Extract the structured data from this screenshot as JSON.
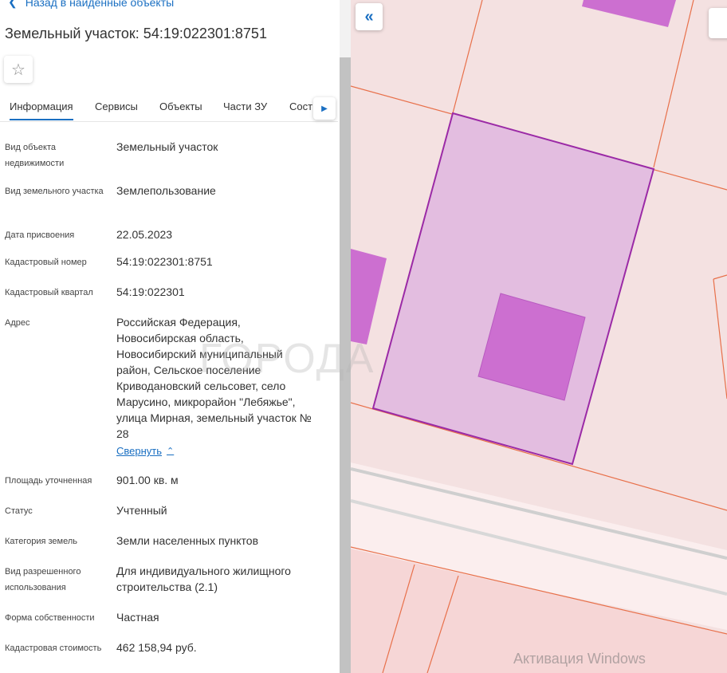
{
  "nav": {
    "back_label": "Назад в найденные объекты"
  },
  "object": {
    "title": "Земельный участок: 54:19:022301:8751"
  },
  "tabs": [
    {
      "label": "Информация"
    },
    {
      "label": "Сервисы"
    },
    {
      "label": "Объекты"
    },
    {
      "label": "Части ЗУ"
    },
    {
      "label": "Сост"
    }
  ],
  "details": {
    "type_label": "Вид объекта недвижимости",
    "type_value": "Земельный участок",
    "plot_kind_label": "Вид земельного участка",
    "plot_kind_value": "Землепользование",
    "date_label": "Дата присвоения",
    "date_value": "22.05.2023",
    "cad_number_label": "Кадастровый номер",
    "cad_number_value": "54:19:022301:8751",
    "cad_quarter_label": "Кадастровый квартал",
    "cad_quarter_value": "54:19:022301",
    "address_label": "Адрес",
    "address_value": "Российская Федерация, Новосибирская область, Новосибирский муниципальный район, Сельское поселение Криводановский сельсовет, село Марусино, микрорайон \"Лебяжье\", улица Мирная, земельный участок № 28",
    "collapse_label": "Свернуть",
    "area_label": "Площадь уточненная",
    "area_value": "901.00 кв. м",
    "status_label": "Статус",
    "status_value": "Учтенный",
    "category_label": "Категория земель",
    "category_value": "Земли населенных пунктов",
    "use_label": "Вид разрешенного использования",
    "use_value": "Для индивидуального жилищного строительства (2.1)",
    "ownership_label": "Форма собственности",
    "ownership_value": "Частная",
    "cost_label": "Кадастровая стоимость",
    "cost_value": "462 158,94 руб."
  },
  "watermark": "ГОРОДА",
  "os_notice": "Активация Windows",
  "icons": {
    "back": "chevron-left-icon",
    "favorite": "star-icon",
    "tab_scroll": "triangle-right-icon",
    "collapse_panel": "double-chevron-left-icon"
  },
  "colors": {
    "accent": "#1a6fc2",
    "parcel_fill": "#e3bde0",
    "parcel_stroke": "#9b2aa6",
    "building_fill": "#cc6fd0",
    "boundary_line": "#e8704a"
  }
}
